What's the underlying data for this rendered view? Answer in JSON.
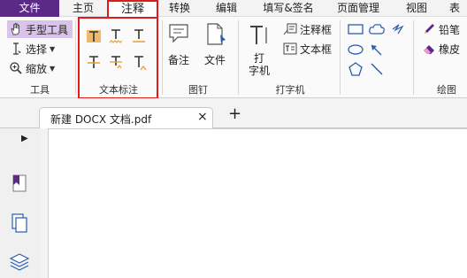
{
  "menu": [
    "文件",
    "主页",
    "注释",
    "转换",
    "编辑",
    "填写&签名",
    "页面管理",
    "视图",
    "表"
  ],
  "tools": {
    "hand": "手型工具",
    "select": "选择",
    "zoom": "缩放",
    "group": "工具"
  },
  "text_markup": {
    "group": "文本标注",
    "icons": [
      "highlight-text-icon",
      "squiggly-underline-icon",
      "underline-icon",
      "strikeout-icon",
      "replace-text-icon",
      "insert-text-icon"
    ]
  },
  "pin": {
    "note": "备注",
    "file": "文件",
    "group": "图钉"
  },
  "typewriter": {
    "typewriter_line1": "打",
    "typewriter_line2": "字机",
    "callout": "注释框",
    "textbox": "文本框",
    "group": "打字机"
  },
  "drawing": {
    "pencil": "铅笔",
    "eraser": "橡皮",
    "group": "绘图"
  },
  "tab": {
    "title": "新建 DOCX 文档.pdf",
    "close": "×",
    "new": "+"
  },
  "colors": {
    "file_menu_bg": "#5b2a86",
    "highlight_red": "#e01b1b",
    "selected_tool_bg": "#d9c3ea",
    "accent_orange": "#e8a33d"
  }
}
